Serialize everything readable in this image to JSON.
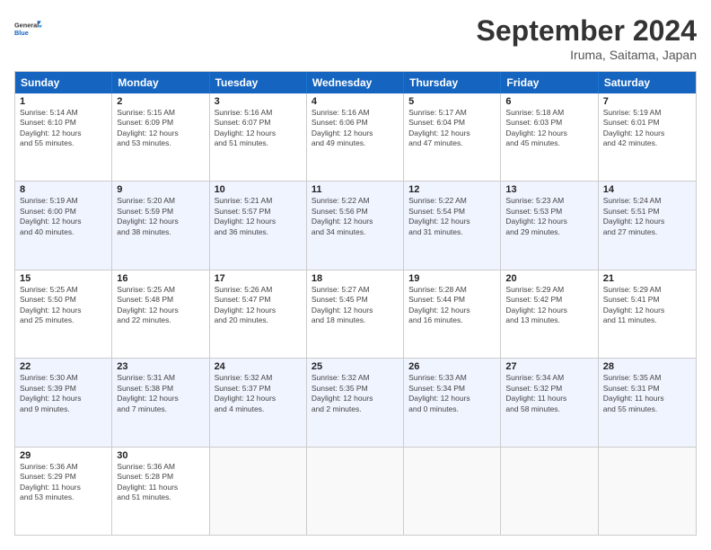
{
  "logo": {
    "text1": "General",
    "text2": "Blue"
  },
  "title": "September 2024",
  "location": "Iruma, Saitama, Japan",
  "weekdays": [
    "Sunday",
    "Monday",
    "Tuesday",
    "Wednesday",
    "Thursday",
    "Friday",
    "Saturday"
  ],
  "rows": [
    [
      {
        "day": "1",
        "lines": [
          "Sunrise: 5:14 AM",
          "Sunset: 6:10 PM",
          "Daylight: 12 hours",
          "and 55 minutes."
        ]
      },
      {
        "day": "2",
        "lines": [
          "Sunrise: 5:15 AM",
          "Sunset: 6:09 PM",
          "Daylight: 12 hours",
          "and 53 minutes."
        ]
      },
      {
        "day": "3",
        "lines": [
          "Sunrise: 5:16 AM",
          "Sunset: 6:07 PM",
          "Daylight: 12 hours",
          "and 51 minutes."
        ]
      },
      {
        "day": "4",
        "lines": [
          "Sunrise: 5:16 AM",
          "Sunset: 6:06 PM",
          "Daylight: 12 hours",
          "and 49 minutes."
        ]
      },
      {
        "day": "5",
        "lines": [
          "Sunrise: 5:17 AM",
          "Sunset: 6:04 PM",
          "Daylight: 12 hours",
          "and 47 minutes."
        ]
      },
      {
        "day": "6",
        "lines": [
          "Sunrise: 5:18 AM",
          "Sunset: 6:03 PM",
          "Daylight: 12 hours",
          "and 45 minutes."
        ]
      },
      {
        "day": "7",
        "lines": [
          "Sunrise: 5:19 AM",
          "Sunset: 6:01 PM",
          "Daylight: 12 hours",
          "and 42 minutes."
        ]
      }
    ],
    [
      {
        "day": "8",
        "lines": [
          "Sunrise: 5:19 AM",
          "Sunset: 6:00 PM",
          "Daylight: 12 hours",
          "and 40 minutes."
        ]
      },
      {
        "day": "9",
        "lines": [
          "Sunrise: 5:20 AM",
          "Sunset: 5:59 PM",
          "Daylight: 12 hours",
          "and 38 minutes."
        ]
      },
      {
        "day": "10",
        "lines": [
          "Sunrise: 5:21 AM",
          "Sunset: 5:57 PM",
          "Daylight: 12 hours",
          "and 36 minutes."
        ]
      },
      {
        "day": "11",
        "lines": [
          "Sunrise: 5:22 AM",
          "Sunset: 5:56 PM",
          "Daylight: 12 hours",
          "and 34 minutes."
        ]
      },
      {
        "day": "12",
        "lines": [
          "Sunrise: 5:22 AM",
          "Sunset: 5:54 PM",
          "Daylight: 12 hours",
          "and 31 minutes."
        ]
      },
      {
        "day": "13",
        "lines": [
          "Sunrise: 5:23 AM",
          "Sunset: 5:53 PM",
          "Daylight: 12 hours",
          "and 29 minutes."
        ]
      },
      {
        "day": "14",
        "lines": [
          "Sunrise: 5:24 AM",
          "Sunset: 5:51 PM",
          "Daylight: 12 hours",
          "and 27 minutes."
        ]
      }
    ],
    [
      {
        "day": "15",
        "lines": [
          "Sunrise: 5:25 AM",
          "Sunset: 5:50 PM",
          "Daylight: 12 hours",
          "and 25 minutes."
        ]
      },
      {
        "day": "16",
        "lines": [
          "Sunrise: 5:25 AM",
          "Sunset: 5:48 PM",
          "Daylight: 12 hours",
          "and 22 minutes."
        ]
      },
      {
        "day": "17",
        "lines": [
          "Sunrise: 5:26 AM",
          "Sunset: 5:47 PM",
          "Daylight: 12 hours",
          "and 20 minutes."
        ]
      },
      {
        "day": "18",
        "lines": [
          "Sunrise: 5:27 AM",
          "Sunset: 5:45 PM",
          "Daylight: 12 hours",
          "and 18 minutes."
        ]
      },
      {
        "day": "19",
        "lines": [
          "Sunrise: 5:28 AM",
          "Sunset: 5:44 PM",
          "Daylight: 12 hours",
          "and 16 minutes."
        ]
      },
      {
        "day": "20",
        "lines": [
          "Sunrise: 5:29 AM",
          "Sunset: 5:42 PM",
          "Daylight: 12 hours",
          "and 13 minutes."
        ]
      },
      {
        "day": "21",
        "lines": [
          "Sunrise: 5:29 AM",
          "Sunset: 5:41 PM",
          "Daylight: 12 hours",
          "and 11 minutes."
        ]
      }
    ],
    [
      {
        "day": "22",
        "lines": [
          "Sunrise: 5:30 AM",
          "Sunset: 5:39 PM",
          "Daylight: 12 hours",
          "and 9 minutes."
        ]
      },
      {
        "day": "23",
        "lines": [
          "Sunrise: 5:31 AM",
          "Sunset: 5:38 PM",
          "Daylight: 12 hours",
          "and 7 minutes."
        ]
      },
      {
        "day": "24",
        "lines": [
          "Sunrise: 5:32 AM",
          "Sunset: 5:37 PM",
          "Daylight: 12 hours",
          "and 4 minutes."
        ]
      },
      {
        "day": "25",
        "lines": [
          "Sunrise: 5:32 AM",
          "Sunset: 5:35 PM",
          "Daylight: 12 hours",
          "and 2 minutes."
        ]
      },
      {
        "day": "26",
        "lines": [
          "Sunrise: 5:33 AM",
          "Sunset: 5:34 PM",
          "Daylight: 12 hours",
          "and 0 minutes."
        ]
      },
      {
        "day": "27",
        "lines": [
          "Sunrise: 5:34 AM",
          "Sunset: 5:32 PM",
          "Daylight: 11 hours",
          "and 58 minutes."
        ]
      },
      {
        "day": "28",
        "lines": [
          "Sunrise: 5:35 AM",
          "Sunset: 5:31 PM",
          "Daylight: 11 hours",
          "and 55 minutes."
        ]
      }
    ],
    [
      {
        "day": "29",
        "lines": [
          "Sunrise: 5:36 AM",
          "Sunset: 5:29 PM",
          "Daylight: 11 hours",
          "and 53 minutes."
        ]
      },
      {
        "day": "30",
        "lines": [
          "Sunrise: 5:36 AM",
          "Sunset: 5:28 PM",
          "Daylight: 11 hours",
          "and 51 minutes."
        ]
      },
      {
        "day": "",
        "lines": []
      },
      {
        "day": "",
        "lines": []
      },
      {
        "day": "",
        "lines": []
      },
      {
        "day": "",
        "lines": []
      },
      {
        "day": "",
        "lines": []
      }
    ]
  ]
}
